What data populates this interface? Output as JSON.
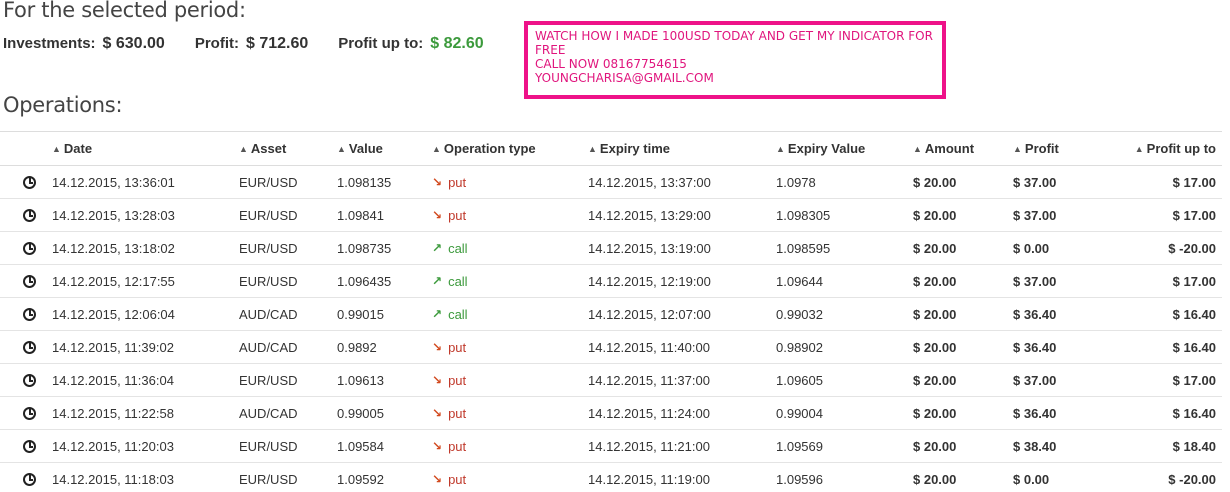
{
  "summary": {
    "title": "For the selected period:",
    "investments_label": "Investments:",
    "investments_value": "$ 630.00",
    "profit_label": "Profit:",
    "profit_value": "$ 712.60",
    "profit_up_to_label": "Profit up to:",
    "profit_up_to_value": "$ 82.60"
  },
  "promo": {
    "line1": "WATCH HOW I MADE 100USD TODAY AND GET MY INDICATOR FOR",
    "line2": "FREE",
    "line3": "CALL NOW 08167754615",
    "line4": "YOUNGCHARISA@GMAIL.COM",
    "color": "#ee1289"
  },
  "operations": {
    "title": "Operations:",
    "columns": {
      "date": "Date",
      "asset": "Asset",
      "value": "Value",
      "operation_type": "Operation type",
      "expiry_time": "Expiry time",
      "expiry_value": "Expiry Value",
      "amount": "Amount",
      "profit": "Profit",
      "profit_up_to": "Profit up to"
    },
    "rows": [
      {
        "date": "14.12.2015, 13:36:01",
        "asset": "EUR/USD",
        "value": "1.098135",
        "type": "put",
        "expiry_time": "14.12.2015, 13:37:00",
        "expiry_value": "1.0978",
        "amount": "$ 20.00",
        "profit": "$ 37.00",
        "profit_up_to": "$ 17.00"
      },
      {
        "date": "14.12.2015, 13:28:03",
        "asset": "EUR/USD",
        "value": "1.09841",
        "type": "put",
        "expiry_time": "14.12.2015, 13:29:00",
        "expiry_value": "1.098305",
        "amount": "$ 20.00",
        "profit": "$ 37.00",
        "profit_up_to": "$ 17.00"
      },
      {
        "date": "14.12.2015, 13:18:02",
        "asset": "EUR/USD",
        "value": "1.098735",
        "type": "call",
        "expiry_time": "14.12.2015, 13:19:00",
        "expiry_value": "1.098595",
        "amount": "$ 20.00",
        "profit": "$ 0.00",
        "profit_up_to": "$ -20.00"
      },
      {
        "date": "14.12.2015, 12:17:55",
        "asset": "EUR/USD",
        "value": "1.096435",
        "type": "call",
        "expiry_time": "14.12.2015, 12:19:00",
        "expiry_value": "1.09644",
        "amount": "$ 20.00",
        "profit": "$ 37.00",
        "profit_up_to": "$ 17.00"
      },
      {
        "date": "14.12.2015, 12:06:04",
        "asset": "AUD/CAD",
        "value": "0.99015",
        "type": "call",
        "expiry_time": "14.12.2015, 12:07:00",
        "expiry_value": "0.99032",
        "amount": "$ 20.00",
        "profit": "$ 36.40",
        "profit_up_to": "$ 16.40"
      },
      {
        "date": "14.12.2015, 11:39:02",
        "asset": "AUD/CAD",
        "value": "0.9892",
        "type": "put",
        "expiry_time": "14.12.2015, 11:40:00",
        "expiry_value": "0.98902",
        "amount": "$ 20.00",
        "profit": "$ 36.40",
        "profit_up_to": "$ 16.40"
      },
      {
        "date": "14.12.2015, 11:36:04",
        "asset": "EUR/USD",
        "value": "1.09613",
        "type": "put",
        "expiry_time": "14.12.2015, 11:37:00",
        "expiry_value": "1.09605",
        "amount": "$ 20.00",
        "profit": "$ 37.00",
        "profit_up_to": "$ 17.00"
      },
      {
        "date": "14.12.2015, 11:22:58",
        "asset": "AUD/CAD",
        "value": "0.99005",
        "type": "put",
        "expiry_time": "14.12.2015, 11:24:00",
        "expiry_value": "0.99004",
        "amount": "$ 20.00",
        "profit": "$ 36.40",
        "profit_up_to": "$ 16.40"
      },
      {
        "date": "14.12.2015, 11:20:03",
        "asset": "EUR/USD",
        "value": "1.09584",
        "type": "put",
        "expiry_time": "14.12.2015, 11:21:00",
        "expiry_value": "1.09569",
        "amount": "$ 20.00",
        "profit": "$ 38.40",
        "profit_up_to": "$ 18.40"
      },
      {
        "date": "14.12.2015, 11:18:03",
        "asset": "EUR/USD",
        "value": "1.09592",
        "type": "put",
        "expiry_time": "14.12.2015, 11:19:00",
        "expiry_value": "1.09596",
        "amount": "$ 20.00",
        "profit": "$ 0.00",
        "profit_up_to": "$ -20.00"
      }
    ]
  },
  "colors": {
    "positive": "#3c9a3c",
    "negative": "#b03a2e",
    "put_arrow": "#d24a1f"
  }
}
